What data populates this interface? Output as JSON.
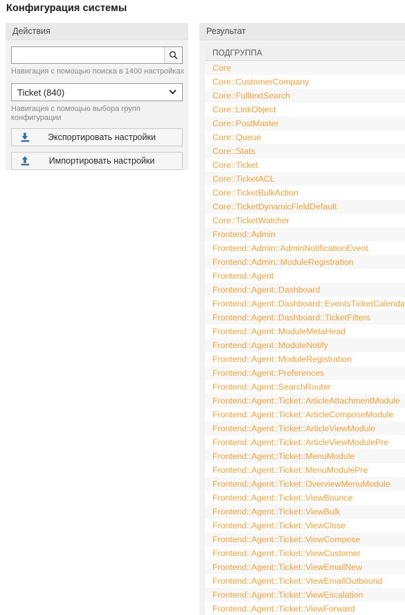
{
  "page": {
    "title": "Конфигурация системы"
  },
  "actions": {
    "header": "Действия",
    "search": {
      "value": "",
      "placeholder": "",
      "button_icon": "search-icon",
      "hint": "Навигация с помощью поиска в 1400 настройках"
    },
    "group_select": {
      "selected": "Ticket (840)",
      "hint": "Навигация с помощью выбора групп конфигурации",
      "chevron_icon": "chevron-down-icon"
    },
    "buttons": [
      {
        "label": "Экспортировать настройки",
        "icon": "download-icon"
      },
      {
        "label": "Импортировать настройки",
        "icon": "upload-icon"
      }
    ]
  },
  "result": {
    "header": "Результат",
    "column_header": "ПОДГРУППА",
    "items": [
      "Core",
      "Core::CustomerCompany",
      "Core::FulltextSearch",
      "Core::LinkObject",
      "Core::PostMaster",
      "Core::Queue",
      "Core::Stats",
      "Core::Ticket",
      "Core::TicketACL",
      "Core::TicketBulkAction",
      "Core::TicketDynamicFieldDefault",
      "Core::TicketWatcher",
      "Frontend::Admin",
      "Frontend::Admin::AdminNotificationEvent",
      "Frontend::Admin::ModuleRegistration",
      "Frontend::Agent",
      "Frontend::Agent::Dashboard",
      "Frontend::Agent::Dashboard::EventsTicketCalendar",
      "Frontend::Agent::Dashboard::TicketFilters",
      "Frontend::Agent::ModuleMetaHead",
      "Frontend::Agent::ModuleNotify",
      "Frontend::Agent::ModuleRegistration",
      "Frontend::Agent::Preferences",
      "Frontend::Agent::SearchRouter",
      "Frontend::Agent::Ticket::ArticleAttachmentModule",
      "Frontend::Agent::Ticket::ArticleComposeModule",
      "Frontend::Agent::Ticket::ArticleViewModule",
      "Frontend::Agent::Ticket::ArticleViewModulePre",
      "Frontend::Agent::Ticket::MenuModule",
      "Frontend::Agent::Ticket::MenuModulePre",
      "Frontend::Agent::Ticket::OverviewMenuModule",
      "Frontend::Agent::Ticket::ViewBounce",
      "Frontend::Agent::Ticket::ViewBulk",
      "Frontend::Agent::Ticket::ViewClose",
      "Frontend::Agent::Ticket::ViewCompose",
      "Frontend::Agent::Ticket::ViewCustomer",
      "Frontend::Agent::Ticket::ViewEmailNew",
      "Frontend::Agent::Ticket::ViewEmailOutbound",
      "Frontend::Agent::Ticket::ViewEscalation",
      "Frontend::Agent::Ticket::ViewForward"
    ]
  },
  "colors": {
    "link": "#f5a037",
    "panel_bg": "#f2f2f2",
    "header_bg": "#e9e9e9",
    "icon_blue": "#2f6a9e"
  }
}
